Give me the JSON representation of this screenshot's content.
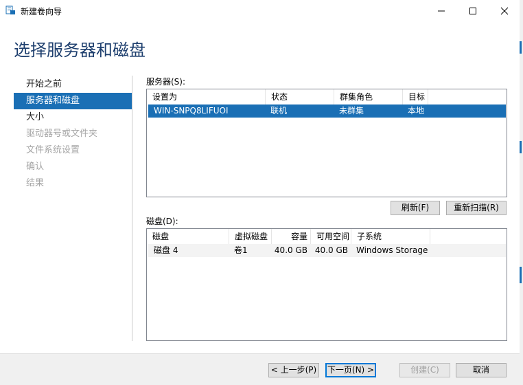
{
  "window": {
    "title": "新建卷向导"
  },
  "page": {
    "title": "选择服务器和磁盘"
  },
  "nav": {
    "items": [
      {
        "label": "开始之前",
        "state": "normal"
      },
      {
        "label": "服务器和磁盘",
        "state": "active"
      },
      {
        "label": "大小",
        "state": "normal"
      },
      {
        "label": "驱动器号或文件夹",
        "state": "disabled"
      },
      {
        "label": "文件系统设置",
        "state": "disabled"
      },
      {
        "label": "确认",
        "state": "disabled"
      },
      {
        "label": "结果",
        "state": "disabled"
      }
    ]
  },
  "servers": {
    "label": "服务器(S):",
    "columns": [
      "设置为",
      "状态",
      "群集角色",
      "目标"
    ],
    "rows": [
      {
        "name": "WIN-SNPQ8LIFUOI",
        "status": "联机",
        "cluster_role": "未群集",
        "destination": "本地",
        "selected": true
      }
    ]
  },
  "actions": {
    "refresh": "刷新(F)",
    "rescan": "重新扫描(R)"
  },
  "disks": {
    "label": "磁盘(D):",
    "columns": [
      "磁盘",
      "虚拟磁盘",
      "容量",
      "可用空间",
      "子系统"
    ],
    "rows": [
      {
        "disk": "磁盘 4",
        "virtual_disk": "卷1",
        "capacity": "40.0 GB",
        "free_space": "40.0 GB",
        "subsystem": "Windows Storage"
      }
    ]
  },
  "footer": {
    "prev": "< 上一步(P)",
    "next": "下一页(N) >",
    "create": "创建(C)",
    "cancel": "取消"
  },
  "colors": {
    "accent": "#1a6fb5",
    "title": "#1e3f6e",
    "disabled": "#a6a6a6"
  }
}
